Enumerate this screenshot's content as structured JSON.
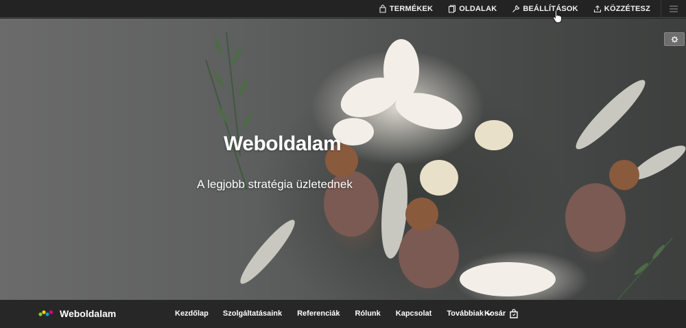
{
  "adminbar": {
    "items": [
      {
        "label": "TERMÉKEK",
        "icon": "bag-icon"
      },
      {
        "label": "OLDALAK",
        "icon": "pages-icon"
      },
      {
        "label": "BEÁLLÍTÁSOK",
        "icon": "wrench-icon"
      },
      {
        "label": "KÖZZÉTESZ",
        "icon": "upload-icon"
      }
    ],
    "menu_icon": "hamburger-menu-icon"
  },
  "hero": {
    "title": "Weboldalam",
    "subtitle": "A legjobb stratégia üzletednek",
    "settings_icon": "gear-icon"
  },
  "sitenav": {
    "brand": "Weboldalam",
    "links": [
      "Kezdőlap",
      "Szolgáltatásaink",
      "Referenciák",
      "Rólunk",
      "Kapcsolat"
    ],
    "more": "Továbbiak",
    "cart": "Kosár"
  },
  "colors": {
    "adminbar_bg": "#232323",
    "nav_bg": "#282828",
    "logo": [
      "#e6007e",
      "#00a0e3",
      "#ffd200",
      "#8cc63f"
    ]
  }
}
